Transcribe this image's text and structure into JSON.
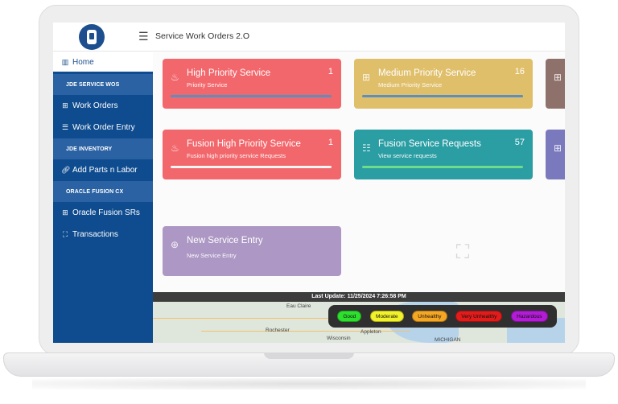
{
  "app": {
    "title": "Service Work Orders 2.O"
  },
  "sidebar": {
    "home": "Home",
    "sections": [
      {
        "label": "JDE SERVICE WOS"
      },
      {
        "label": "JDE INVENTORY"
      },
      {
        "label": "ORACLE FUSION CX"
      }
    ],
    "items": [
      {
        "label": "Work Orders",
        "icon": "grid-icon"
      },
      {
        "label": "Work Order Entry",
        "icon": "list-icon"
      },
      {
        "label": "Add Parts n Labor",
        "icon": "link-icon"
      },
      {
        "label": "Oracle Fusion SRs",
        "icon": "grid-icon"
      },
      {
        "label": "Transactions",
        "icon": "expand-icon"
      }
    ]
  },
  "cards": [
    {
      "title": "High Priority Service",
      "subtitle": "Priority Service",
      "count": "1",
      "color": "#f2676c",
      "bar": "#5a8fc0",
      "icon": "flame-icon"
    },
    {
      "title": "Medium Priority Service",
      "subtitle": "Medium Priority Service",
      "count": "16",
      "color": "#e0bf6b",
      "bar": "#5a8fc0",
      "icon": "grid-icon"
    },
    {
      "title": "Fusion High Priority Service",
      "subtitle": "Fusion high priority service Requests",
      "count": "1",
      "color": "#f2676c",
      "bar": "#f5f5f5",
      "icon": "flame-icon"
    },
    {
      "title": "Fusion Service Requests",
      "subtitle": "View service requests",
      "count": "57",
      "color": "#2b9ea4",
      "bar": "#6fdc8c",
      "icon": "server-icon"
    },
    {
      "title": "New Service Entry",
      "subtitle": "New Service Entry",
      "count": "",
      "color": "#ad97c4",
      "bar": "",
      "icon": "plus-circle-icon"
    }
  ],
  "update": {
    "text": "Last Update: 11/25/2024 7:26:58 PM"
  },
  "map": {
    "labels": [
      "Eau Claire",
      "Rochester",
      "Appleton",
      "Wisconsin",
      "MICHIGAN"
    ]
  },
  "legend": [
    {
      "label": "Good",
      "color": "#2ee02e"
    },
    {
      "label": "Moderate",
      "color": "#f2f22a"
    },
    {
      "label": "Unhealthy",
      "color": "#f5a623"
    },
    {
      "label": "Very Unhealthy",
      "color": "#e21b1b"
    },
    {
      "label": "Hazardous",
      "color": "#b31bd6"
    }
  ]
}
